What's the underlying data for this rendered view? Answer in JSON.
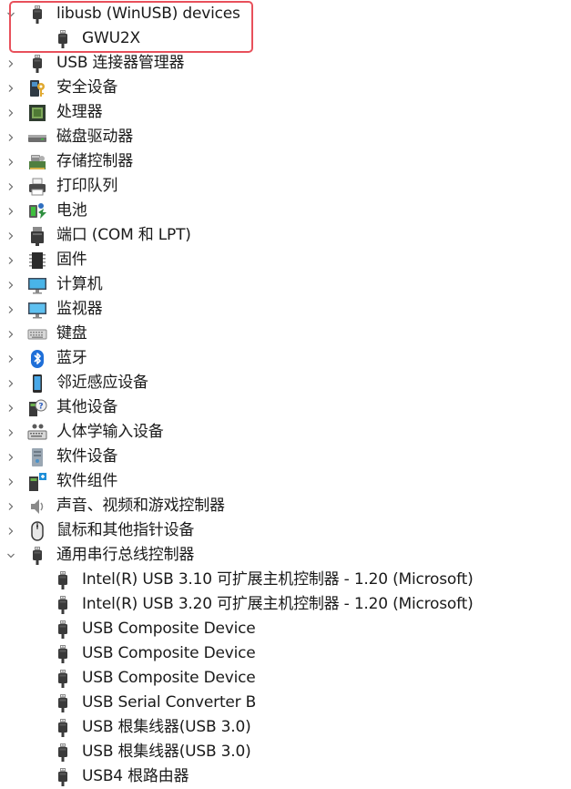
{
  "tree": {
    "items": [
      {
        "level": 0,
        "expander": "expanded",
        "icon": "usb-plug-icon",
        "label": "libusb (WinUSB) devices"
      },
      {
        "level": 1,
        "expander": "none",
        "icon": "usb-plug-icon",
        "label": "GWU2X"
      },
      {
        "level": 0,
        "expander": "collapsed",
        "icon": "usb-plug-icon",
        "label": "USB 连接器管理器"
      },
      {
        "level": 0,
        "expander": "collapsed",
        "icon": "security-key-icon",
        "label": "安全设备"
      },
      {
        "level": 0,
        "expander": "collapsed",
        "icon": "processor-chip-icon",
        "label": "处理器"
      },
      {
        "level": 0,
        "expander": "collapsed",
        "icon": "disk-drive-icon",
        "label": "磁盘驱动器"
      },
      {
        "level": 0,
        "expander": "collapsed",
        "icon": "storage-controller-icon",
        "label": "存储控制器"
      },
      {
        "level": 0,
        "expander": "collapsed",
        "icon": "printer-icon",
        "label": "打印队列"
      },
      {
        "level": 0,
        "expander": "collapsed",
        "icon": "battery-icon",
        "label": "电池"
      },
      {
        "level": 0,
        "expander": "collapsed",
        "icon": "port-connector-icon",
        "label": "端口 (COM 和 LPT)"
      },
      {
        "level": 0,
        "expander": "collapsed",
        "icon": "firmware-chip-icon",
        "label": "固件"
      },
      {
        "level": 0,
        "expander": "collapsed",
        "icon": "computer-monitor-icon",
        "label": "计算机"
      },
      {
        "level": 0,
        "expander": "collapsed",
        "icon": "monitor-icon",
        "label": "监视器"
      },
      {
        "level": 0,
        "expander": "collapsed",
        "icon": "keyboard-icon",
        "label": "键盘"
      },
      {
        "level": 0,
        "expander": "collapsed",
        "icon": "bluetooth-icon",
        "label": "蓝牙"
      },
      {
        "level": 0,
        "expander": "collapsed",
        "icon": "proximity-device-icon",
        "label": "邻近感应设备"
      },
      {
        "level": 0,
        "expander": "collapsed",
        "icon": "unknown-device-icon",
        "label": "其他设备"
      },
      {
        "level": 0,
        "expander": "collapsed",
        "icon": "human-interface-device-icon",
        "label": "人体学输入设备"
      },
      {
        "level": 0,
        "expander": "collapsed",
        "icon": "software-device-icon",
        "label": "软件设备"
      },
      {
        "level": 0,
        "expander": "collapsed",
        "icon": "software-component-icon",
        "label": "软件组件"
      },
      {
        "level": 0,
        "expander": "collapsed",
        "icon": "speaker-icon",
        "label": "声音、视频和游戏控制器"
      },
      {
        "level": 0,
        "expander": "collapsed",
        "icon": "mouse-icon",
        "label": "鼠标和其他指针设备"
      },
      {
        "level": 0,
        "expander": "expanded",
        "icon": "usb-plug-icon",
        "label": "通用串行总线控制器"
      },
      {
        "level": 1,
        "expander": "none",
        "icon": "usb-plug-icon",
        "label": "Intel(R) USB 3.10 可扩展主机控制器 - 1.20 (Microsoft)"
      },
      {
        "level": 1,
        "expander": "none",
        "icon": "usb-plug-icon",
        "label": "Intel(R) USB 3.20 可扩展主机控制器 - 1.20 (Microsoft)"
      },
      {
        "level": 1,
        "expander": "none",
        "icon": "usb-plug-icon",
        "label": "USB Composite Device"
      },
      {
        "level": 1,
        "expander": "none",
        "icon": "usb-plug-icon",
        "label": "USB Composite Device"
      },
      {
        "level": 1,
        "expander": "none",
        "icon": "usb-plug-icon",
        "label": "USB Composite Device"
      },
      {
        "level": 1,
        "expander": "none",
        "icon": "usb-plug-icon",
        "label": "USB Serial Converter B"
      },
      {
        "level": 1,
        "expander": "none",
        "icon": "usb-plug-icon",
        "label": "USB 根集线器(USB 3.0)"
      },
      {
        "level": 1,
        "expander": "none",
        "icon": "usb-plug-icon",
        "label": "USB 根集线器(USB 3.0)"
      },
      {
        "level": 1,
        "expander": "none",
        "icon": "usb-plug-icon",
        "label": "USB4 根路由器"
      }
    ]
  },
  "colors": {
    "highlight_border": "#e8505b",
    "text": "#1a1a1a",
    "chevron": "#6b6b6b"
  }
}
